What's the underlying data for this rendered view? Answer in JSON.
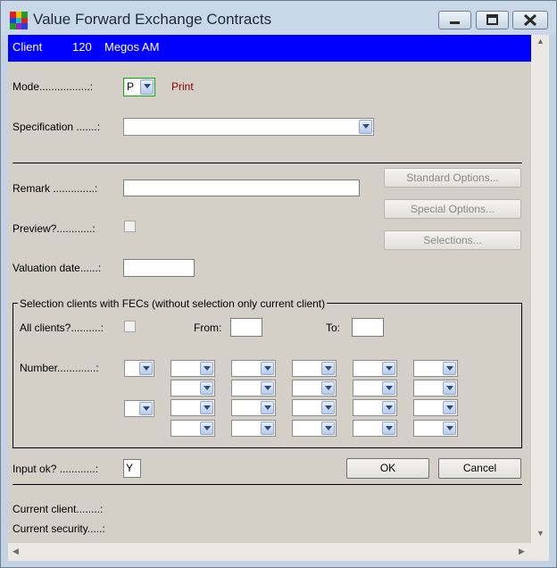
{
  "window": {
    "title": "Value Forward Exchange Contracts",
    "controls": [
      "minimize-icon",
      "maximize-icon",
      "close-icon"
    ]
  },
  "client": {
    "label": "Client",
    "number": "120",
    "name": "Megos AM"
  },
  "form": {
    "mode_label": "Mode.................:",
    "mode_value": "P",
    "mode_text": "Print",
    "specification_label": "Specification .......:",
    "specification_value": "",
    "remark_label": "Remark ..............:",
    "remark_value": "",
    "preview_label": "Preview?............:",
    "valuation_label": "Valuation date......:",
    "valuation_value": ""
  },
  "buttons": {
    "standard": "Standard Options...",
    "special": "Special Options...",
    "selections": "Selections...",
    "ok": "OK",
    "cancel": "Cancel"
  },
  "selection_group": {
    "title": "Selection clients with FECs (without selection only current client)",
    "all_clients_label": "All clients?..........:",
    "from_label": "From:",
    "from_value": "",
    "to_label": "To:",
    "to_value": "",
    "number_label": "Number.............:"
  },
  "input_ok": {
    "label": "Input ok? ............:",
    "value": "Y"
  },
  "status": {
    "current_client_label": "Current client........:",
    "current_security_label": "Current security.....:"
  },
  "colors": {
    "client_bar": "#0000ff",
    "print_text": "#8b0000",
    "content_bg": "#d4d0c8"
  }
}
